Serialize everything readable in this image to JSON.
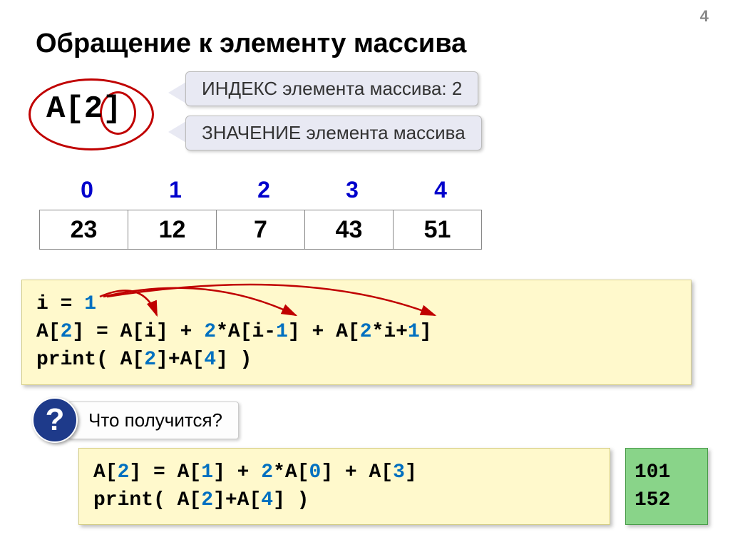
{
  "page_number": "4",
  "title": "Обращение к элементу массива",
  "array_expr": "A[2]",
  "callout_index": "ИНДЕКС элемента массива: 2",
  "callout_value": "ЗНАЧЕНИЕ элемента массива",
  "indices": [
    "0",
    "1",
    "2",
    "3",
    "4"
  ],
  "cells": [
    "23",
    "12",
    "7",
    "43",
    "51"
  ],
  "code1_l1a": "i = ",
  "code1_l1b": "1",
  "code1_l2a": "A[",
  "code1_l2b": "2",
  "code1_l2c": "] = A[i] + ",
  "code1_l2d": "2",
  "code1_l2e": "*A[i-",
  "code1_l2f": "1",
  "code1_l2g": "] + A[",
  "code1_l2h": "2",
  "code1_l2i": "*i+",
  "code1_l2j": "1",
  "code1_l2k": "]",
  "code1_l3a": "print( A[",
  "code1_l3b": "2",
  "code1_l3c": "]+A[",
  "code1_l3d": "4",
  "code1_l3e": "] )",
  "question_mark": "?",
  "question_label": "Что получится?",
  "code2_l1a": "A[",
  "code2_l1b": "2",
  "code2_l1c": "] = A[",
  "code2_l1d": "1",
  "code2_l1e": "] + ",
  "code2_l1f": "2",
  "code2_l1g": "*A[",
  "code2_l1h": "0",
  "code2_l1i": "] + A[",
  "code2_l1j": "3",
  "code2_l1k": "]",
  "code2_l2a": "print( A[",
  "code2_l2b": "2",
  "code2_l2c": "]+A[",
  "code2_l2d": "4",
  "code2_l2e": "] )",
  "result1": "101",
  "result2": "152"
}
